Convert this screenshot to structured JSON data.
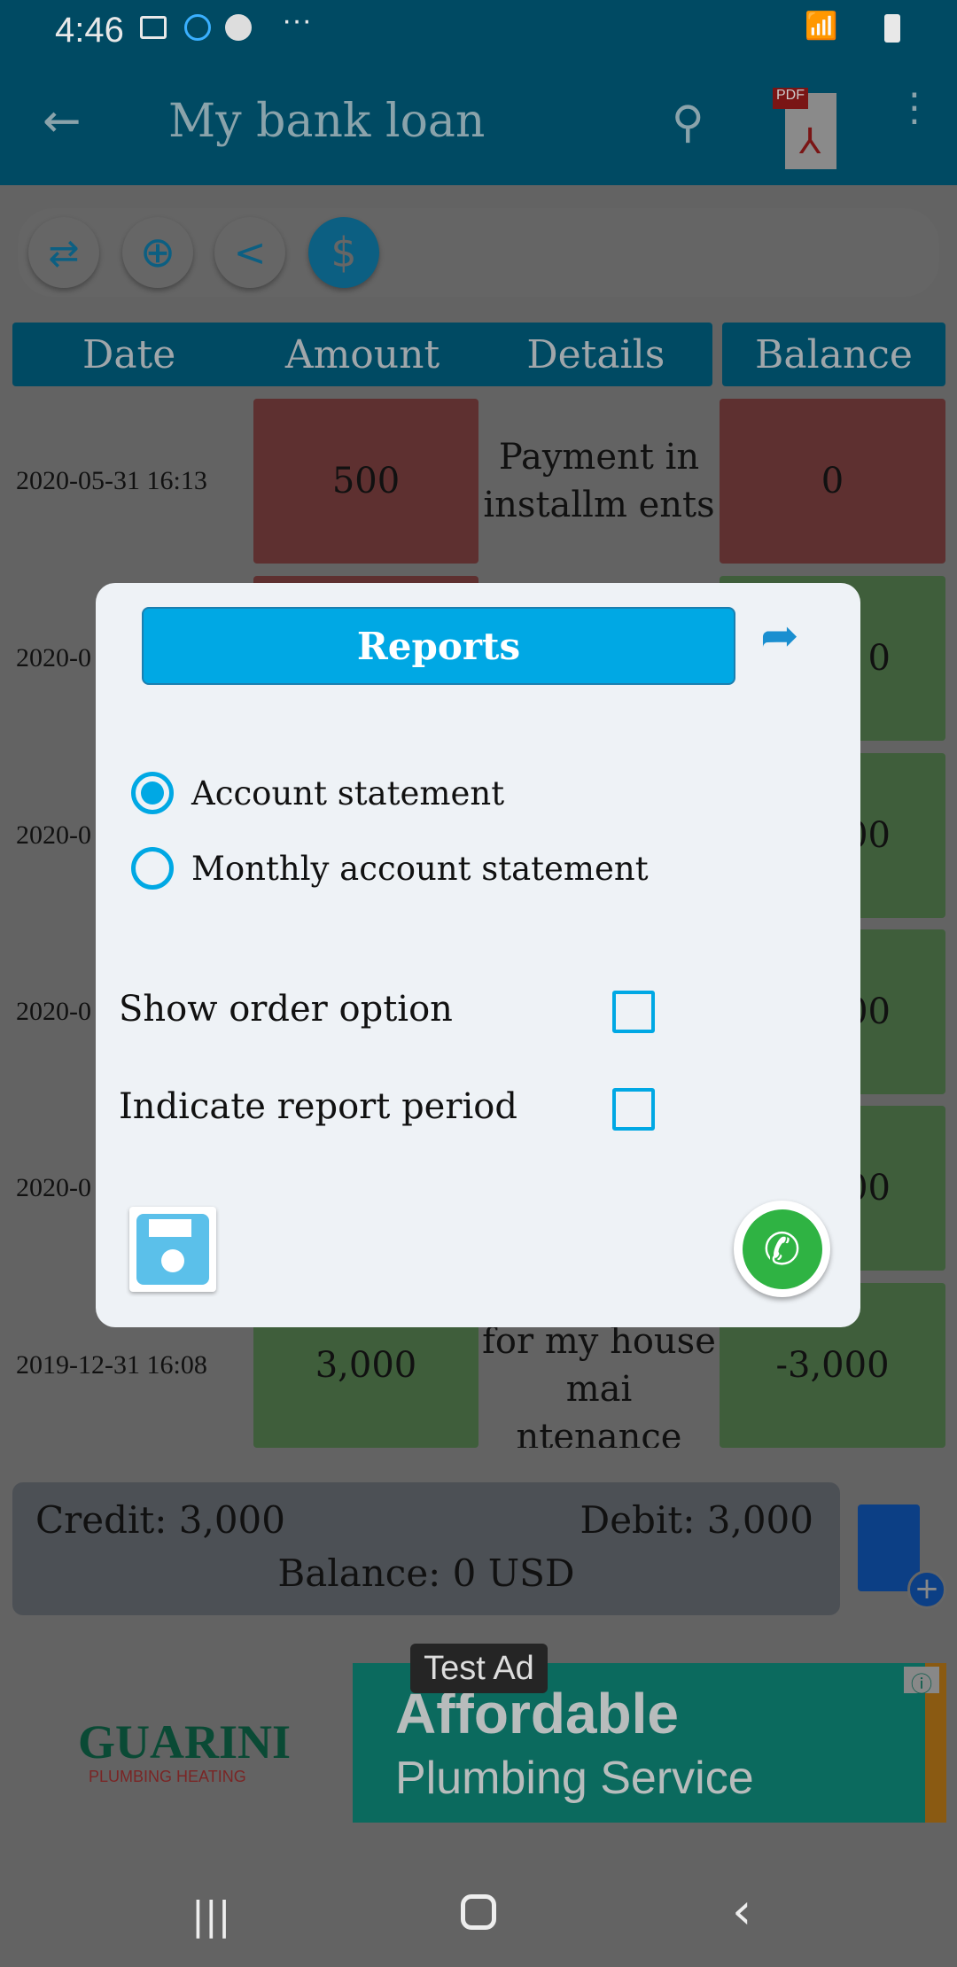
{
  "status_bar": {
    "time": "4:46"
  },
  "app_bar": {
    "title": "My bank loan",
    "pdf_label": "PDF"
  },
  "table": {
    "headers": [
      "Date",
      "Amount",
      "Details",
      "Balance"
    ],
    "rows": [
      {
        "date": "2020-05-31 16:13",
        "amount": "500",
        "details": "Payment in installm ents",
        "balance": "0",
        "amount_color": "red",
        "balance_color": "red"
      },
      {
        "date": "2020-0",
        "amount": "",
        "details": "",
        "balance": "0",
        "amount_color": "red",
        "balance_color": "green"
      },
      {
        "date": "2020-0",
        "amount": "",
        "details": "",
        "balance": "00",
        "amount_color": "green",
        "balance_color": "green"
      },
      {
        "date": "2020-0",
        "amount": "",
        "details": "",
        "balance": "00",
        "amount_color": "green",
        "balance_color": "green"
      },
      {
        "date": "2020-0",
        "amount": "",
        "details": "",
        "balance": "00",
        "amount_color": "green",
        "balance_color": "green"
      },
      {
        "date": "2019-12-31 16:08",
        "amount": "3,000",
        "details": "loan taken for my house mai ntenance",
        "balance": "-3,000",
        "amount_color": "green",
        "balance_color": "green"
      }
    ]
  },
  "summary": {
    "credit": "Credit: 3,000",
    "debit": "Debit: 3,000",
    "balance": "Balance: 0 USD"
  },
  "ad": {
    "badge": "Test Ad",
    "logo": "GUARINI",
    "logo_sub": "PLUMBING HEATING",
    "headline": "Affordable",
    "subline": "Plumbing Service"
  },
  "dialog": {
    "title": "Reports",
    "options": [
      {
        "label": "Account statement",
        "selected": true
      },
      {
        "label": "Monthly account statement",
        "selected": false
      }
    ],
    "checkboxes": [
      {
        "label": "Show order option",
        "checked": false
      },
      {
        "label": "Indicate report period",
        "checked": false
      }
    ]
  },
  "colors": {
    "accent": "#00a8e4",
    "app_bar": "#0a7ea6",
    "debit_red": "#e07272",
    "credit_green": "#96df8c"
  }
}
